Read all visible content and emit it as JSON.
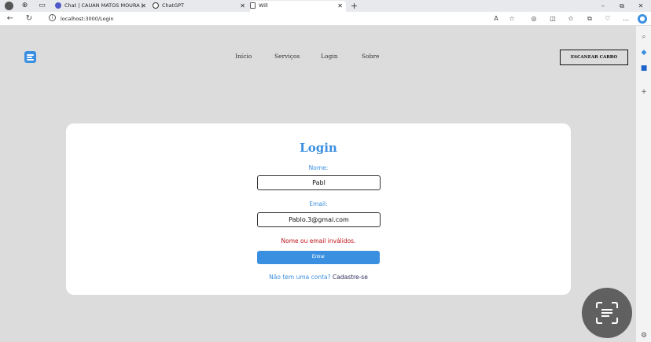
{
  "browser": {
    "tabs": [
      {
        "title": "Chat | CAUAN MATOS MOURA |",
        "icon": "teams-icon",
        "active": false
      },
      {
        "title": "ChatGPT",
        "icon": "chatgpt-icon",
        "active": false
      },
      {
        "title": "Will",
        "icon": "page-icon",
        "active": true
      }
    ],
    "new_tab_symbol": "+",
    "url": "localhost:3000/Login",
    "window_controls": {
      "minimize": "–",
      "maximize": "⧉",
      "close": "✕"
    }
  },
  "site": {
    "nav": [
      "Início",
      "Serviços",
      "Login",
      "Sobre"
    ],
    "scan_button": "ESCANEAR CARRO"
  },
  "login": {
    "title": "Login",
    "name_label": "Nome:",
    "name_value": "Pabl",
    "email_label": "Email:",
    "email_value": "Pablo.3@gmai.com",
    "error": "Nome ou email inválidos.",
    "submit": "Entrar",
    "signup_question": "Não tem uma conta?",
    "signup_link": "Cadastre-se"
  },
  "colors": {
    "accent": "#3a8fe0",
    "error": "#c0141a",
    "page_bg": "#dcdcdc",
    "card_bg": "#ffffff"
  }
}
